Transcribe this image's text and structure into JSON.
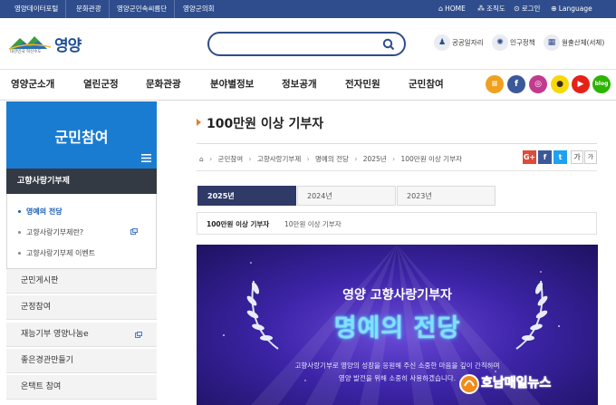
{
  "top_bar": {
    "left_links": [
      "영양데이터포털",
      "문화관광",
      "영양군민속씨름단",
      "영양군의회"
    ],
    "home": "HOME",
    "org": "조직도",
    "login": "로그인",
    "language": "Language"
  },
  "header": {
    "logo_text": "영양",
    "logo_slogan": "대한민국 혁신수도",
    "search_placeholder": "",
    "links": [
      "공공일자리",
      "인구정책",
      "월출산체(서체)"
    ]
  },
  "gnb": [
    "영양군소개",
    "열린군정",
    "문화관광",
    "분야별정보",
    "정보공개",
    "전자민원",
    "군민참여"
  ],
  "social": [
    "menu-icon",
    "facebook-icon",
    "instagram-icon",
    "kakao-icon",
    "youtube-icon",
    "blog"
  ],
  "social_blog_label": "blog",
  "sidebar": {
    "title": "군민참여",
    "section": "고향사랑기부제",
    "sub_items": [
      "영예의 전당",
      "고향사랑기부제란?",
      "고향사랑기부제 이벤트"
    ],
    "items": [
      "군민게시판",
      "군정참여",
      "재능기부 영양나눔e",
      "좋은경관만들기",
      "온택트 참여"
    ]
  },
  "content": {
    "title": "100만원 이상 기부자",
    "breadcrumb": [
      "군민참여",
      "고향사랑기부제",
      "명예의 전당",
      "2025년",
      "100만원 이상 기부자"
    ],
    "font_size_labels": [
      "가",
      "가"
    ],
    "year_tabs": [
      "2025년",
      "2024년",
      "2023년"
    ],
    "sub_tabs": [
      "100만원 이상 기부자",
      "10만원 이상 기부자"
    ]
  },
  "banner": {
    "subtitle": "영양 고향사랑기부자",
    "title": "명예의 전당",
    "desc1": "고향사랑기부로 영양의 성장을 응원해 주신 소중한 마음을 깊이 간직하며",
    "desc2": "영양 발전을 위해 소중히 사용하겠습니다."
  },
  "watermark": "호남매일뉴스",
  "colors": {
    "topbar": "#2f4d8c",
    "sidebar_head": "#1a7cd0",
    "tab_active": "#2f3a67",
    "accent_orange": "#e0802c"
  }
}
